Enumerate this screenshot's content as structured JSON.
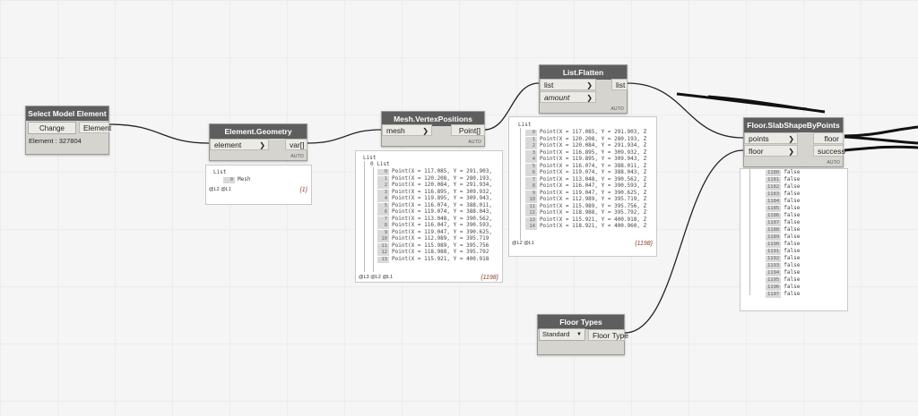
{
  "nodes": {
    "select_model_element": {
      "title": "Select Model Element",
      "change_label": "Change",
      "output": "Element",
      "info": "Element : 327804"
    },
    "element_geometry": {
      "title": "Element.Geometry",
      "input": "element",
      "output": "var[]",
      "lacing": "AUTO"
    },
    "mesh_vertex_positions": {
      "title": "Mesh.VertexPositions",
      "input": "mesh",
      "output": "Point[]",
      "lacing": "AUTO"
    },
    "list_flatten": {
      "title": "List.Flatten",
      "input1": "list",
      "input2": "amount",
      "output": "list",
      "lacing": "AUTO"
    },
    "floor_slab_shape_by_points": {
      "title": "Floor.SlabShapeByPoints",
      "input1": "points",
      "input2": "floor",
      "output1": "floor",
      "output2": "success",
      "lacing": "AUTO"
    },
    "floor_types": {
      "title": "Floor Types",
      "selected": "Standard",
      "output": "Floor Type"
    }
  },
  "watches": {
    "geometry": {
      "header": "List",
      "rows": [
        {
          "idx": "0",
          "text": "Mesh"
        }
      ],
      "footer_levels": "@L2 @L1",
      "count": "{1}"
    },
    "vertex": {
      "header": "List",
      "sub_header": "0 List",
      "rows": [
        {
          "idx": "0",
          "text": "Point(X = 117.085, Y = 291.903,"
        },
        {
          "idx": "1",
          "text": "Point(X = 120.208, Y = 280.193,"
        },
        {
          "idx": "2",
          "text": "Point(X = 120.084, Y = 291.934,"
        },
        {
          "idx": "3",
          "text": "Point(X = 116.895, Y = 309.932,"
        },
        {
          "idx": "4",
          "text": "Point(X = 119.895, Y = 309.943,"
        },
        {
          "idx": "5",
          "text": "Point(X = 116.074, Y = 388.011,"
        },
        {
          "idx": "6",
          "text": "Point(X = 119.074, Y = 388.043,"
        },
        {
          "idx": "7",
          "text": "Point(X = 113.048, Y = 390.562,"
        },
        {
          "idx": "8",
          "text": "Point(X = 116.047, Y = 390.593,"
        },
        {
          "idx": "9",
          "text": "Point(X = 119.047, Y = 390.625,"
        },
        {
          "idx": "10",
          "text": "Point(X = 112.989, Y = 395.719"
        },
        {
          "idx": "11",
          "text": "Point(X = 115.989, Y = 395.756"
        },
        {
          "idx": "12",
          "text": "Point(X = 118.988, Y = 395.792"
        },
        {
          "idx": "13",
          "text": "Point(X = 115.921, Y = 400.918"
        }
      ],
      "footer_levels": "@L3 @L2 @L1",
      "count": "{1198}"
    },
    "flatten": {
      "header": "List",
      "rows": [
        {
          "idx": "0",
          "text": "Point(X = 117.085, Y = 291.903, Z"
        },
        {
          "idx": "1",
          "text": "Point(X = 120.208, Y = 280.193, Z"
        },
        {
          "idx": "2",
          "text": "Point(X = 120.084, Y = 291.934, Z"
        },
        {
          "idx": "3",
          "text": "Point(X = 116.895, Y = 309.932, Z"
        },
        {
          "idx": "4",
          "text": "Point(X = 119.895, Y = 309.943, Z"
        },
        {
          "idx": "5",
          "text": "Point(X = 116.074, Y = 388.011, Z"
        },
        {
          "idx": "6",
          "text": "Point(X = 119.074, Y = 388.043, Z"
        },
        {
          "idx": "7",
          "text": "Point(X = 113.048, Y = 390.562, Z"
        },
        {
          "idx": "8",
          "text": "Point(X = 116.047, Y = 390.593, Z"
        },
        {
          "idx": "9",
          "text": "Point(X = 119.047, Y = 390.625, Z"
        },
        {
          "idx": "10",
          "text": "Point(X = 112.989, Y = 395.719, Z"
        },
        {
          "idx": "11",
          "text": "Point(X = 115.989, Y = 395.756, Z"
        },
        {
          "idx": "12",
          "text": "Point(X = 118.988, Y = 395.792, Z"
        },
        {
          "idx": "13",
          "text": "Point(X = 115.921, Y = 400.918, Z"
        },
        {
          "idx": "14",
          "text": "Point(X = 118.921, Y = 400.960, Z"
        }
      ],
      "footer_levels": "@L2 @L1",
      "count": "{1198}"
    },
    "slab": {
      "rows": [
        {
          "idx": "1180",
          "text": "false"
        },
        {
          "idx": "1181",
          "text": "false"
        },
        {
          "idx": "1182",
          "text": "false"
        },
        {
          "idx": "1183",
          "text": "false"
        },
        {
          "idx": "1184",
          "text": "false"
        },
        {
          "idx": "1185",
          "text": "false"
        },
        {
          "idx": "1186",
          "text": "false"
        },
        {
          "idx": "1187",
          "text": "false"
        },
        {
          "idx": "1188",
          "text": "false"
        },
        {
          "idx": "1189",
          "text": "false"
        },
        {
          "idx": "1190",
          "text": "false"
        },
        {
          "idx": "1191",
          "text": "false"
        },
        {
          "idx": "1192",
          "text": "false"
        },
        {
          "idx": "1193",
          "text": "false"
        },
        {
          "idx": "1194",
          "text": "false"
        },
        {
          "idx": "1195",
          "text": "false"
        },
        {
          "idx": "1196",
          "text": "false"
        },
        {
          "idx": "1197",
          "text": "false"
        }
      ]
    }
  },
  "colors": {
    "canvas": "#f5f5f5",
    "node_header": "#5e5e5e",
    "node_body": "#d6d4cf",
    "wire": "#222222"
  }
}
